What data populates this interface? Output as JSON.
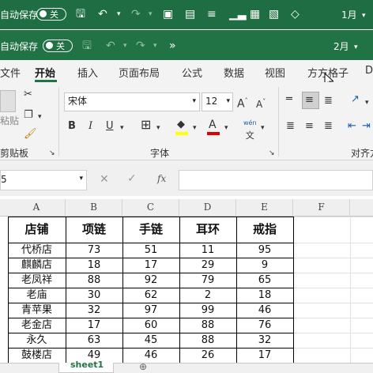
{
  "titlebar_back": {
    "autosave_label": "自动保存",
    "toggle_label": "关",
    "filename": "1月"
  },
  "titlebar_front": {
    "autosave_label": "自动保存",
    "toggle_label": "关",
    "filename": "2月",
    "more": "»"
  },
  "tabs": [
    "文件",
    "开始",
    "插入",
    "页面布局",
    "公式",
    "数据",
    "视图",
    "方方格子",
    "D"
  ],
  "ribbon": {
    "clipboard": {
      "paste_label": "粘贴",
      "group_label": "剪贴板"
    },
    "font": {
      "font_name": "宋体",
      "font_size": "12",
      "bold": "B",
      "italic": "I",
      "underline": "U",
      "wen": "wén",
      "wen_sub": "文",
      "group_label": "字体",
      "grow": "A",
      "shrink": "A",
      "color_letter": "A"
    },
    "align": {
      "group_label": "对齐方"
    }
  },
  "formula_bar": {
    "name_box": "5",
    "fx": "fx"
  },
  "sheet": {
    "columns": [
      "A",
      "B",
      "C",
      "D",
      "E",
      "F"
    ],
    "header_row": [
      "店铺",
      "项链",
      "手链",
      "耳环",
      "戒指"
    ],
    "rows": [
      [
        "代桥店",
        "73",
        "51",
        "11",
        "95"
      ],
      [
        "麒麟店",
        "18",
        "17",
        "29",
        "9"
      ],
      [
        "老凤祥",
        "88",
        "92",
        "79",
        "65"
      ],
      [
        "老庙",
        "30",
        "62",
        "2",
        "18"
      ],
      [
        "青苹果",
        "32",
        "97",
        "99",
        "46"
      ],
      [
        "老金店",
        "17",
        "60",
        "88",
        "76"
      ],
      [
        "永久",
        "63",
        "45",
        "88",
        "32"
      ],
      [
        "鼓楼店",
        "49",
        "46",
        "26",
        "17"
      ]
    ],
    "sheet_tab": "sheet1"
  },
  "colors": {
    "title_bar": "#217346",
    "accent": "#217346",
    "grid": "#000000"
  }
}
